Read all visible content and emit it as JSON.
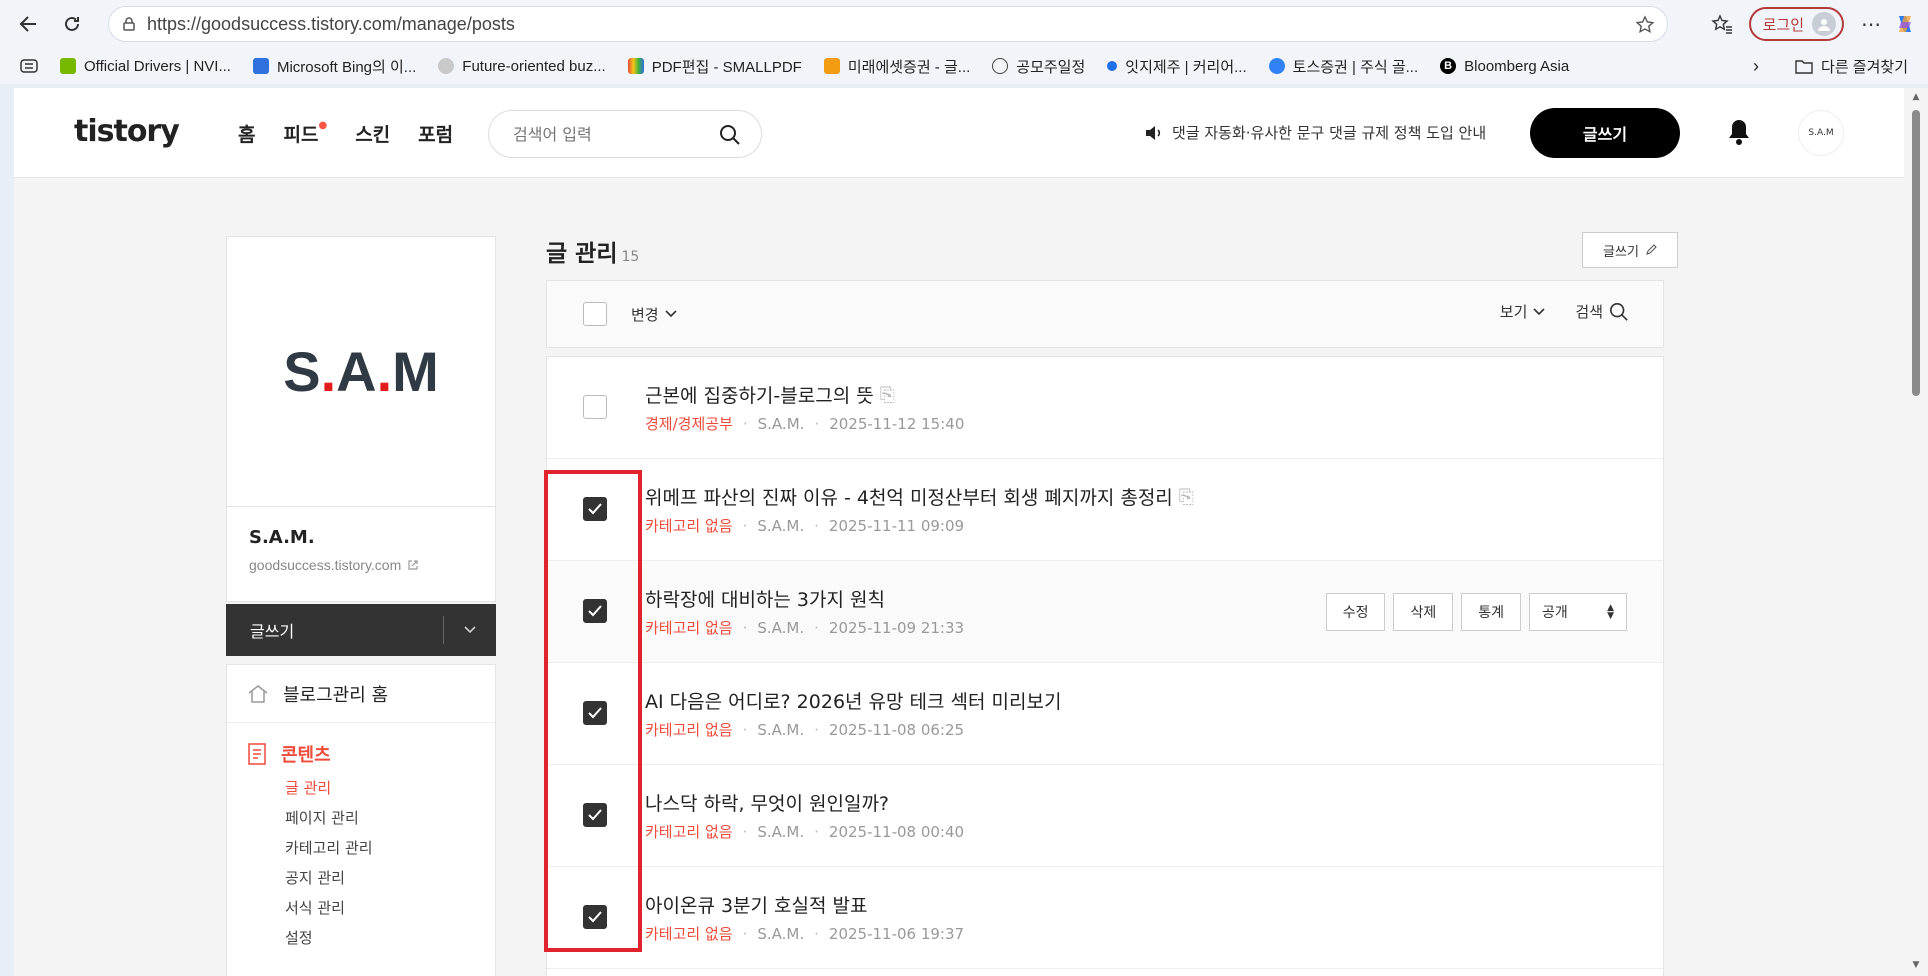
{
  "browser": {
    "url": "https://goodsuccess.tistory.com/manage/posts",
    "login_label": "로그인",
    "bookmarks": [
      {
        "label": "Official Drivers | NVI...",
        "color": "#76b900"
      },
      {
        "label": "Microsoft Bing의 이...",
        "color": "#2f6fde"
      },
      {
        "label": "Future-oriented buz...",
        "color": "#c9c9c9"
      },
      {
        "label": "PDF편집 - SMALLPDF",
        "color": "#e84b3c"
      },
      {
        "label": "미래에셋증권 - 글...",
        "color": "#f39c12"
      },
      {
        "label": "공모주일정",
        "color": "#444444"
      },
      {
        "label": "잇지제주 | 커리어...",
        "color": "#1f6feb"
      },
      {
        "label": "토스증권 | 주식 골...",
        "color": "#3182f6"
      },
      {
        "label": "Bloomberg Asia",
        "color": "#000000"
      }
    ],
    "other_bookmarks": "다른 즐겨찾기"
  },
  "header": {
    "logo": "tistory",
    "nav": [
      "홈",
      "피드",
      "스킨",
      "포럼"
    ],
    "search_placeholder": "검색어 입력",
    "notice": "댓글 자동화·유사한 문구 댓글 규제 정책 도입 안내",
    "write_label": "글쓰기",
    "avatar_label": "S.A.M"
  },
  "sidebar": {
    "profile_logo_parts": [
      "S",
      ".",
      "A",
      ".",
      "M"
    ],
    "blog_name": "S.A.M.",
    "blog_url": "goodsuccess.tistory.com",
    "write_label": "글쓰기",
    "home_label": "블로그관리 홈",
    "section_label": "콘텐츠",
    "sub_items": [
      "글 관리",
      "페이지 관리",
      "카테고리 관리",
      "공지 관리",
      "서식 관리",
      "설정"
    ]
  },
  "main": {
    "title": "글 관리",
    "count": "15",
    "write_small": "글쓰기",
    "toolbar": {
      "change": "변경",
      "view": "보기",
      "search": "검색"
    },
    "posts": [
      {
        "title": "근본에 집중하기-블로그의 뜻",
        "category": "경제/경제공부",
        "author": "S.A.M.",
        "date": "2025-11-12 15:40",
        "checked": false,
        "clip": true
      },
      {
        "title": "위메프 파산의 진짜 이유 - 4천억 미정산부터 회생 폐지까지 총정리",
        "category": "카테고리 없음",
        "author": "S.A.M.",
        "date": "2025-11-11 09:09",
        "checked": true,
        "clip": true
      },
      {
        "title": "하락장에 대비하는 3가지 원칙",
        "category": "카테고리 없음",
        "author": "S.A.M.",
        "date": "2025-11-09 21:33",
        "checked": true,
        "clip": false
      },
      {
        "title": "AI 다음은 어디로? 2026년 유망 테크 섹터 미리보기",
        "category": "카테고리 없음",
        "author": "S.A.M.",
        "date": "2025-11-08 06:25",
        "checked": true,
        "clip": false
      },
      {
        "title": "나스닥 하락, 무엇이 원인일까?",
        "category": "카테고리 없음",
        "author": "S.A.M.",
        "date": "2025-11-08 00:40",
        "checked": true,
        "clip": false
      },
      {
        "title": "아이온큐 3분기 호실적 발표",
        "category": "카테고리 없음",
        "author": "S.A.M.",
        "date": "2025-11-06 19:37",
        "checked": true,
        "clip": false
      }
    ],
    "post_actions": {
      "edit": "수정",
      "delete": "삭제",
      "stats": "통계",
      "visibility": "공개"
    }
  },
  "colors": {
    "accent": "#ef4b3a",
    "highlight": "#e0232c",
    "dark": "#333333"
  }
}
